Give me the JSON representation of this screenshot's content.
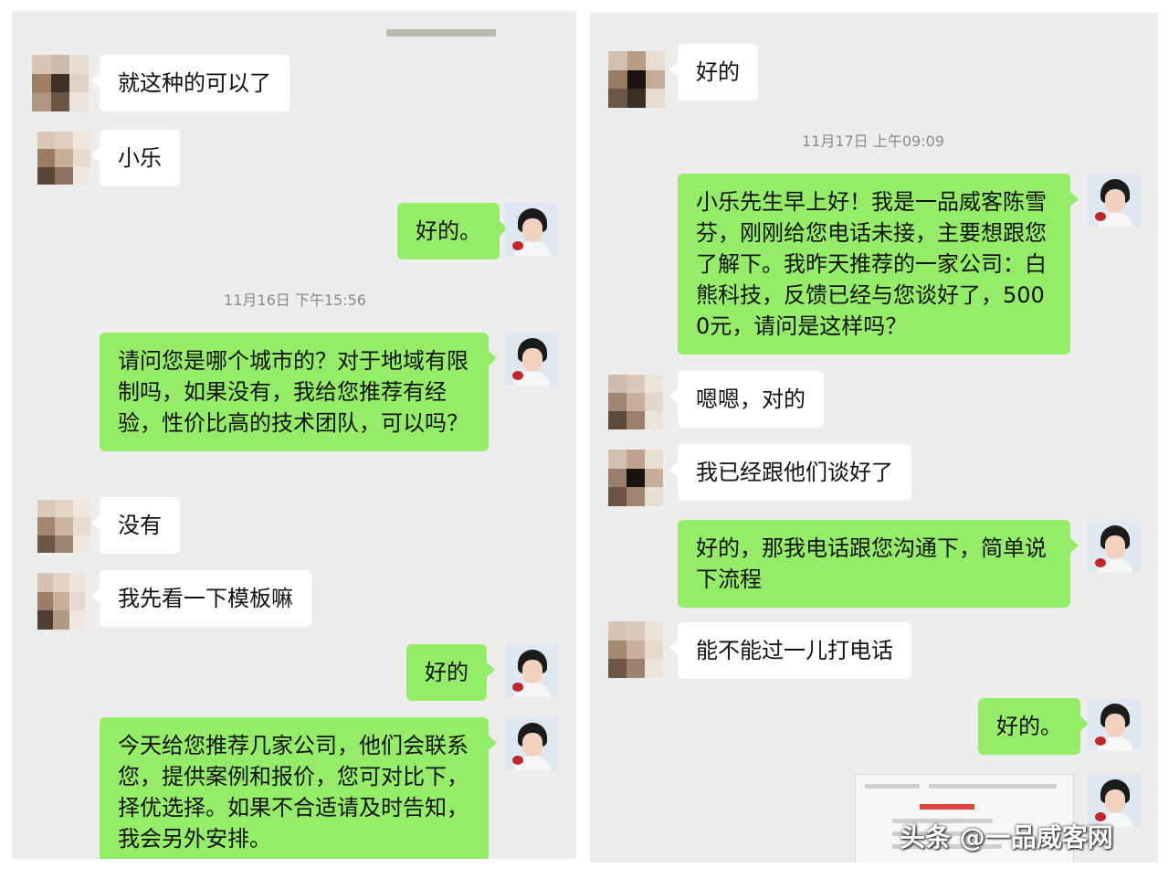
{
  "left_panel": {
    "messages": [
      {
        "text": "就这种的可以了"
      },
      {
        "text": "小乐"
      },
      {
        "text": "好的。"
      },
      {
        "text": "请问您是哪个城市的？对于地域有限制吗，如果没有，我给您推荐有经验，性价比高的技术团队，可以吗？"
      },
      {
        "text": "没有"
      },
      {
        "text": "我先看一下模板嘛"
      },
      {
        "text": "好的"
      },
      {
        "text": "今天给您推荐几家公司，他们会联系您，提供案例和报价，您可对比下，择优选择。如果不合适请及时告知，我会另外安排。"
      }
    ],
    "timestamp": "11月16日 下午15:56"
  },
  "right_panel": {
    "messages": [
      {
        "text": "好的"
      },
      {
        "text": "小乐先生早上好！我是一品威客陈雪芬，刚刚给您电话未接，主要想跟您了解下。我昨天推荐的一家公司：白熊科技，反馈已经与您谈好了，5000元，请问是这样吗？"
      },
      {
        "text": "嗯嗯，对的"
      },
      {
        "text": "我已经跟他们谈好了"
      },
      {
        "text": "好的，那我电话跟您沟通下，简单说下流程"
      },
      {
        "text": "能不能过一儿打电话"
      },
      {
        "text": "好的。"
      }
    ],
    "timestamp": "11月17日 上午09:09"
  },
  "watermark": "头条 @一品威客网",
  "colors": {
    "chat_bg": "#ededed",
    "outgoing_bubble": "#95ec69",
    "incoming_bubble": "#ffffff"
  }
}
